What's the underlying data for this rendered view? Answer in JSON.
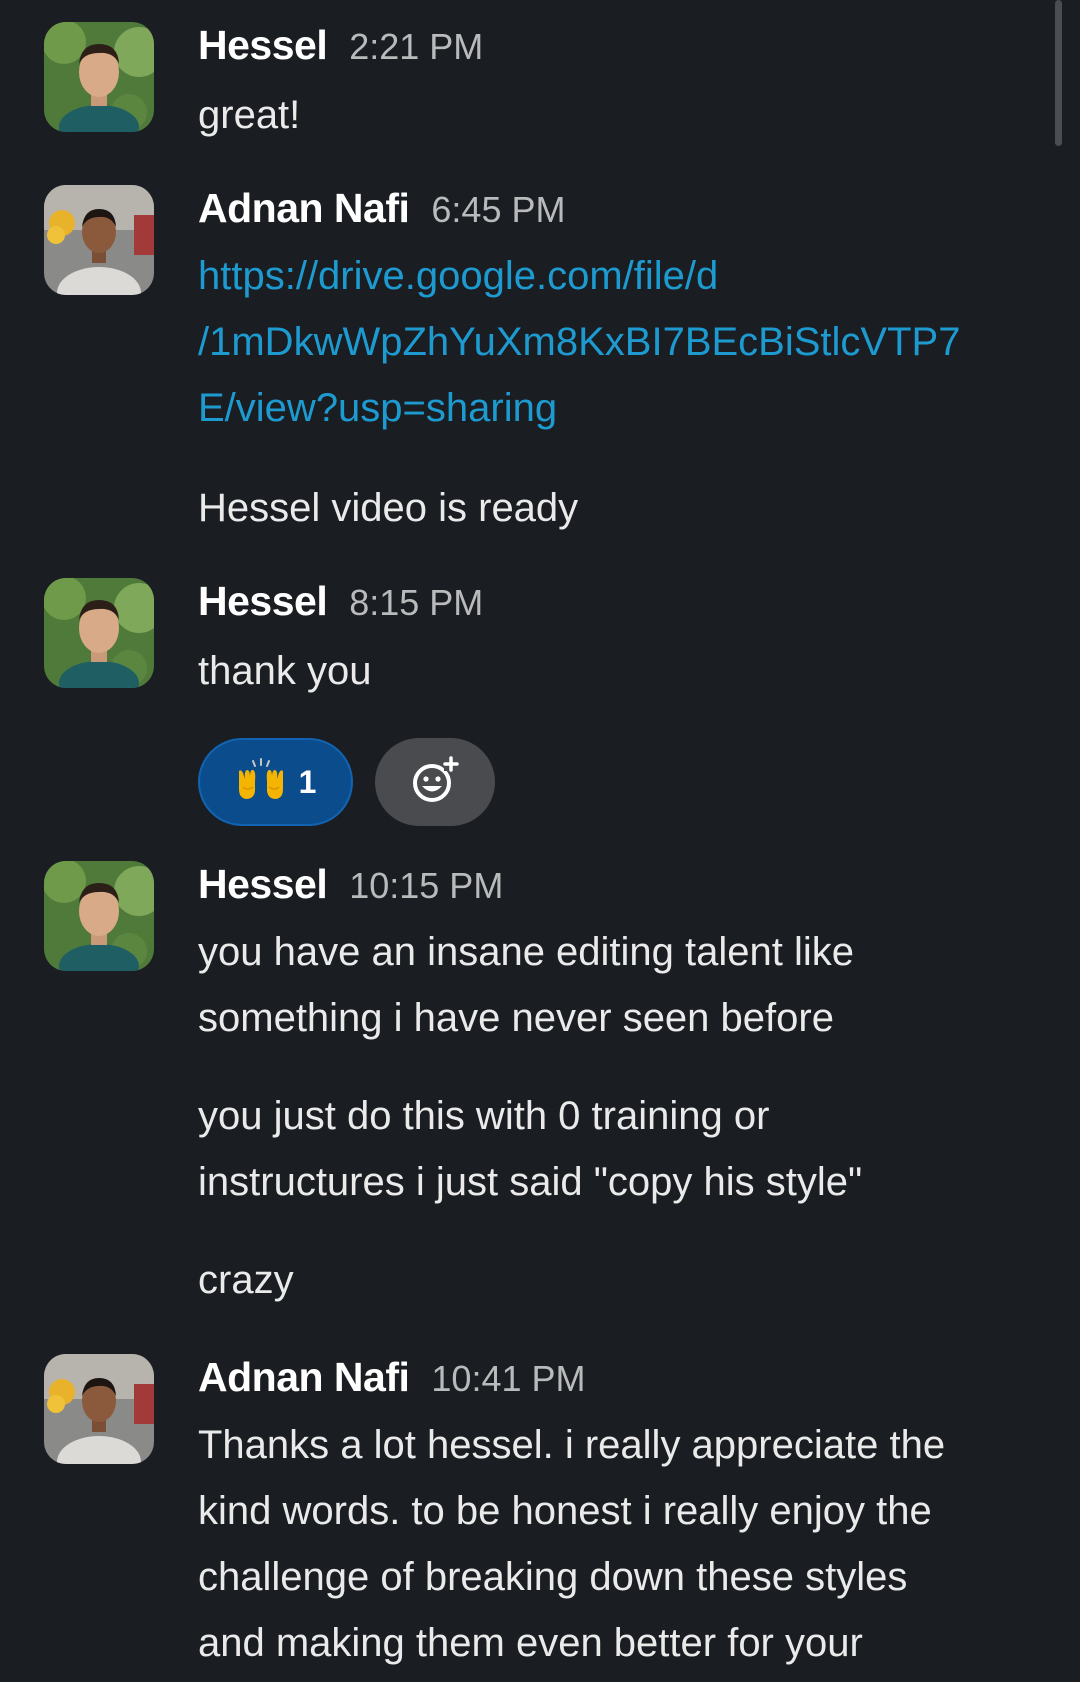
{
  "messages": [
    {
      "author": "Hessel",
      "time": "2:21 PM",
      "paragraphs": [
        "great!"
      ]
    },
    {
      "author": "Adnan Nafi",
      "time": "6:45 PM",
      "link": "https://drive.google.com/file/d/1mDkwWpZhYuXm8KxBI7BEcBiStlcVTP7E/view?usp=sharing",
      "link_lines": [
        "https://drive.google.com/file/d",
        "/1mDkwWpZhYuXm8KxBI7BEcBiStlcVTP7",
        "E/view?usp=sharing"
      ],
      "paragraphs": [
        "Hessel video is ready"
      ]
    },
    {
      "author": "Hessel",
      "time": "8:15 PM",
      "paragraphs": [
        "thank you"
      ],
      "reactions": [
        {
          "emoji": "raising-hands",
          "count": "1"
        }
      ]
    },
    {
      "author": "Hessel",
      "time": "10:15 PM",
      "paragraphs": [
        [
          "you have an insane editing talent like",
          "something i have never seen before"
        ],
        [
          "you just do this with 0 training or",
          "instructures i just said \"copy his style\""
        ],
        [
          "crazy"
        ]
      ]
    },
    {
      "author": "Adnan Nafi",
      "time": "10:41 PM",
      "paragraphs": [
        [
          "Thanks a lot hessel. i really appreciate the",
          "kind words. to be honest i really enjoy the",
          "challenge of breaking down these styles",
          "and making them even better for your"
        ]
      ]
    }
  ],
  "colors": {
    "background": "#1a1d21",
    "link": "#1d9bd1",
    "reaction_active_bg": "#0b4d8c",
    "reaction_add_bg": "#4a4b4e"
  },
  "icons": {
    "reaction_emoji": "raising-hands-icon",
    "add_reaction": "add-reaction-icon"
  }
}
